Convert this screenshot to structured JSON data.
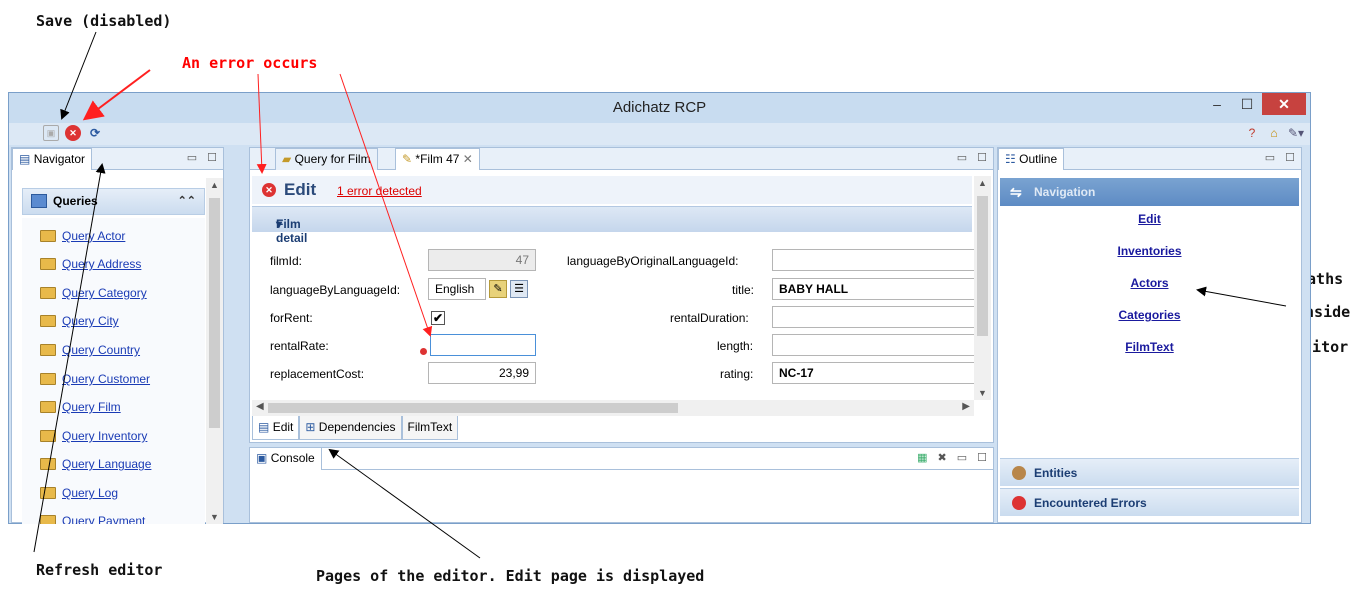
{
  "annotations": {
    "save_disabled": "Save (disabled)",
    "error_occurs": "An error occurs",
    "paths_line1": "Paths",
    "paths_line2": "inside",
    "paths_line3": "editor",
    "refresh_editor": "Refresh editor",
    "pages_editor": "Pages of the editor. Edit page is displayed"
  },
  "window": {
    "title": "Adichatz RCP",
    "minimize": "–",
    "maximize": "☐",
    "close": "✕"
  },
  "toolbar": {
    "icons": [
      "save-icon",
      "error-icon",
      "refresh-icon",
      "help-icon",
      "home-icon",
      "wrench-icon"
    ]
  },
  "navigator": {
    "tab_label": "Navigator",
    "section_title": "Queries",
    "items": [
      "Query Actor",
      "Query Address",
      "Query Category",
      "Query City",
      "Query Country",
      "Query Customer",
      "Query Film",
      "Query Inventory",
      "Query Language",
      "Query Log",
      "Query Payment"
    ]
  },
  "editor": {
    "tabs": [
      "Query for Film",
      "*Film 47"
    ],
    "header_title": "Edit",
    "error_link": "1 error detected",
    "section_title": "Film detail",
    "fields": {
      "filmId_label": "filmId:",
      "filmId_value": "47",
      "languageByLanguageId_label": "languageByLanguageId:",
      "languageByLanguageId_value": "English",
      "forRent_label": "forRent:",
      "forRent_value": "✔",
      "rentalRate_label": "rentalRate:",
      "rentalRate_value": "",
      "replacementCost_label": "replacementCost:",
      "replacementCost_value": "23,99",
      "languageByOriginalLanguageId_label": "languageByOriginalLanguageId:",
      "languageByOriginalLanguageId_value": "",
      "title_label": "title:",
      "title_value": "BABY HALL",
      "rentalDuration_label": "rentalDuration:",
      "rentalDuration_value": "",
      "length_label": "length:",
      "length_value": "",
      "rating_label": "rating:",
      "rating_value": "NC-17"
    },
    "pages": [
      "Edit",
      "Dependencies",
      "FilmText"
    ]
  },
  "console": {
    "tab_label": "Console"
  },
  "outline": {
    "tab_label": "Outline",
    "navigation_title": "Navigation",
    "links": [
      "Edit",
      "Inventories",
      "Actors",
      "Categories",
      "FilmText"
    ],
    "entities": "Entities",
    "encountered_errors": "Encountered Errors"
  },
  "colors": {
    "annotation_red": "#ff0000",
    "error_red": "#d33333",
    "link_blue": "#1a3bb5",
    "navigation_header": "#5d8bc4"
  }
}
